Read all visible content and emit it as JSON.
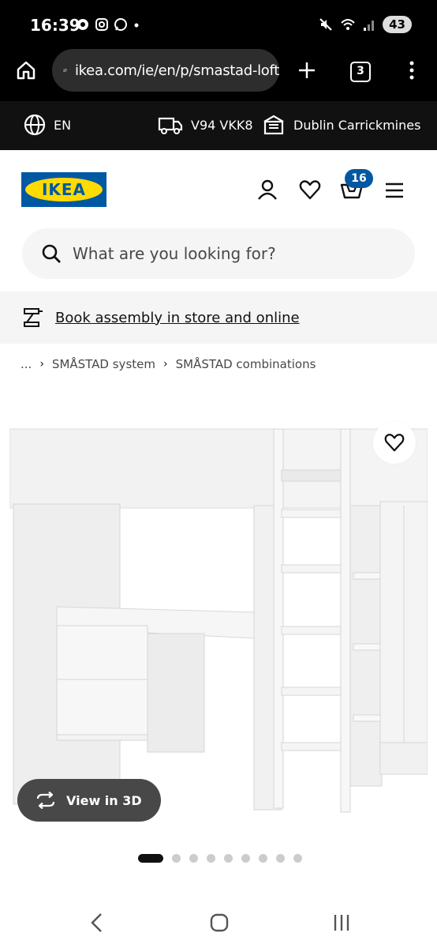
{
  "status_bar": {
    "time": "16:39",
    "battery": "43"
  },
  "browser": {
    "url": "ikea.com/ie/en/p/smastad-loft",
    "tab_count": "3"
  },
  "topbar": {
    "language": "EN",
    "postcode": "V94 VKK8",
    "store": "Dublin Carrickmines"
  },
  "header": {
    "logo_text": "IKEA",
    "cart_count": "16"
  },
  "search": {
    "placeholder": "What are you looking for?"
  },
  "assembly": {
    "link_text": "Book assembly in store and online"
  },
  "breadcrumb": {
    "ellipsis": "...",
    "items": [
      "SMÅSTAD system",
      "SMÅSTAD combinations"
    ]
  },
  "product": {
    "view_3d_label": "View in 3D",
    "image_count": 9,
    "active_image": 1
  },
  "colors": {
    "ikea_blue": "#0058a3",
    "ikea_yellow": "#ffdb00",
    "dark": "#111111"
  }
}
